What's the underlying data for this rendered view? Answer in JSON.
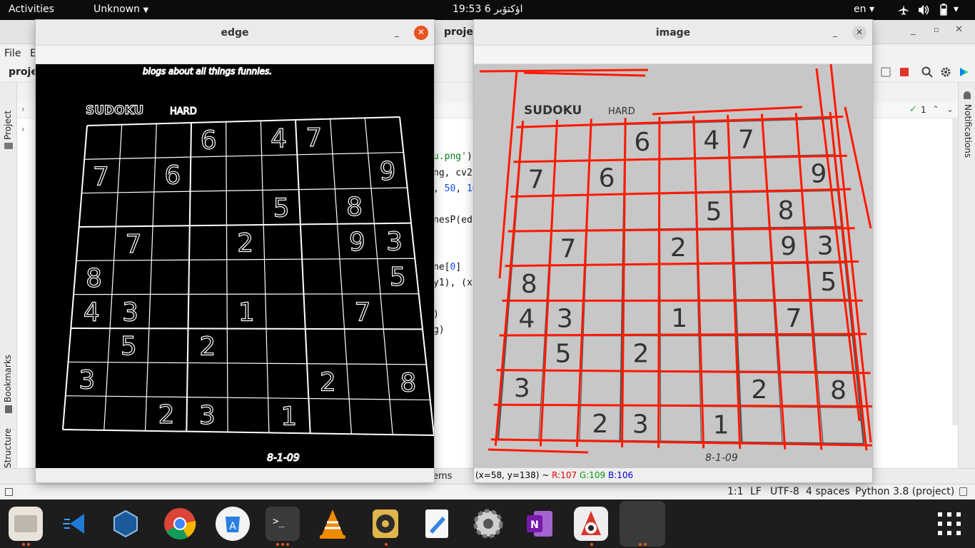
{
  "topbar": {
    "activities": "Activities",
    "app_menu": "Unknown",
    "clock": "19:53 6 اؤکتۆبر",
    "lang": "en",
    "lang_arrow": "▾"
  },
  "ide": {
    "project_title": "projec",
    "menu": [
      "File",
      "E"
    ],
    "breadcrumb": "proje",
    "left_tabs": [
      "Project",
      "Bookmarks",
      "Structure"
    ],
    "right_tabs": [
      "Notifications"
    ],
    "inspection_count": "1",
    "code_lines": [
      {
        "pre": "",
        "str": "u.png'",
        "post": ")"
      },
      {
        "pre": "ng, cv2.",
        "str": "",
        "post": ""
      },
      {
        "pre": ", ",
        "num1": "50",
        "mid": ", ",
        "num2": "10"
      },
      {
        "pre": "nesP(ed",
        "str": "",
        "post": ""
      },
      {
        "pre": "ne[",
        "num1": "0",
        "post": "]"
      },
      {
        "pre": "y1), (x",
        "str": "",
        "post": ""
      },
      {
        "pre": ")",
        "str": "",
        "post": ""
      },
      {
        "pre": "g)",
        "str": "",
        "post": ""
      }
    ],
    "run_tail": "ems",
    "status": {
      "position": "1:1",
      "line_sep": "LF",
      "encoding": "UTF-8",
      "indent": "4 spaces",
      "interpreter": "Python 3.8 (project)"
    }
  },
  "edge_window": {
    "title": "edge",
    "minimize": "_",
    "close": "✕"
  },
  "image_window": {
    "title": "image",
    "minimize": "_",
    "close": "✕",
    "status_coords": "(x=58, y=138) ~ ",
    "status_r": "R:107",
    "status_g": "G:109",
    "status_b": "B:106"
  },
  "sudoku": {
    "header": "SUDOKU",
    "level": "HARD",
    "blurb": "blogs about all things funnies.",
    "date": "8-1-09",
    "grid": [
      [
        "",
        "",
        "",
        "6",
        "",
        "4",
        "7",
        "",
        ""
      ],
      [
        "7",
        "",
        "6",
        "",
        "",
        "",
        "",
        "",
        "9"
      ],
      [
        "",
        "",
        "",
        "",
        "",
        "5",
        "",
        "8",
        ""
      ],
      [
        "",
        "7",
        "",
        "",
        "2",
        "",
        "",
        "9",
        "3"
      ],
      [
        "8",
        "",
        "",
        "",
        "",
        "",
        "",
        "",
        "5"
      ],
      [
        "4",
        "3",
        "",
        "",
        "1",
        "",
        "",
        "7",
        ""
      ],
      [
        "",
        "5",
        "",
        "2",
        "",
        "",
        "",
        "",
        ""
      ],
      [
        "3",
        "",
        "",
        "",
        "",
        "",
        "2",
        "",
        "8"
      ],
      [
        "",
        "",
        "2",
        "3",
        "",
        "1",
        "",
        "",
        ""
      ]
    ]
  },
  "dock": {
    "apps": [
      {
        "name": "files",
        "color": "#8c8c8c",
        "running": 2
      },
      {
        "name": "vscode-like",
        "color": "#1d1d1d",
        "running": 0
      },
      {
        "name": "virtualbox",
        "color": "#1d1d1d",
        "running": 0
      },
      {
        "name": "chrome",
        "color": "#1d1d1d",
        "running": 0
      },
      {
        "name": "software",
        "color": "#1d1d1d",
        "running": 0
      },
      {
        "name": "terminal",
        "color": "#3c3c3c",
        "running": 3
      },
      {
        "name": "vlc",
        "color": "#1d1d1d",
        "running": 0
      },
      {
        "name": "rhythmbox",
        "color": "#1d1d1d",
        "running": 1
      },
      {
        "name": "text-editor",
        "color": "#1d1d1d",
        "running": 0
      },
      {
        "name": "settings",
        "color": "#1d1d1d",
        "running": 0
      },
      {
        "name": "onenote",
        "color": "#1d1d1d",
        "running": 0
      },
      {
        "name": "java",
        "color": "#1d1d1d",
        "running": 1
      },
      {
        "name": "python-windows",
        "color": "#3a3a3a",
        "running": 2
      }
    ]
  }
}
